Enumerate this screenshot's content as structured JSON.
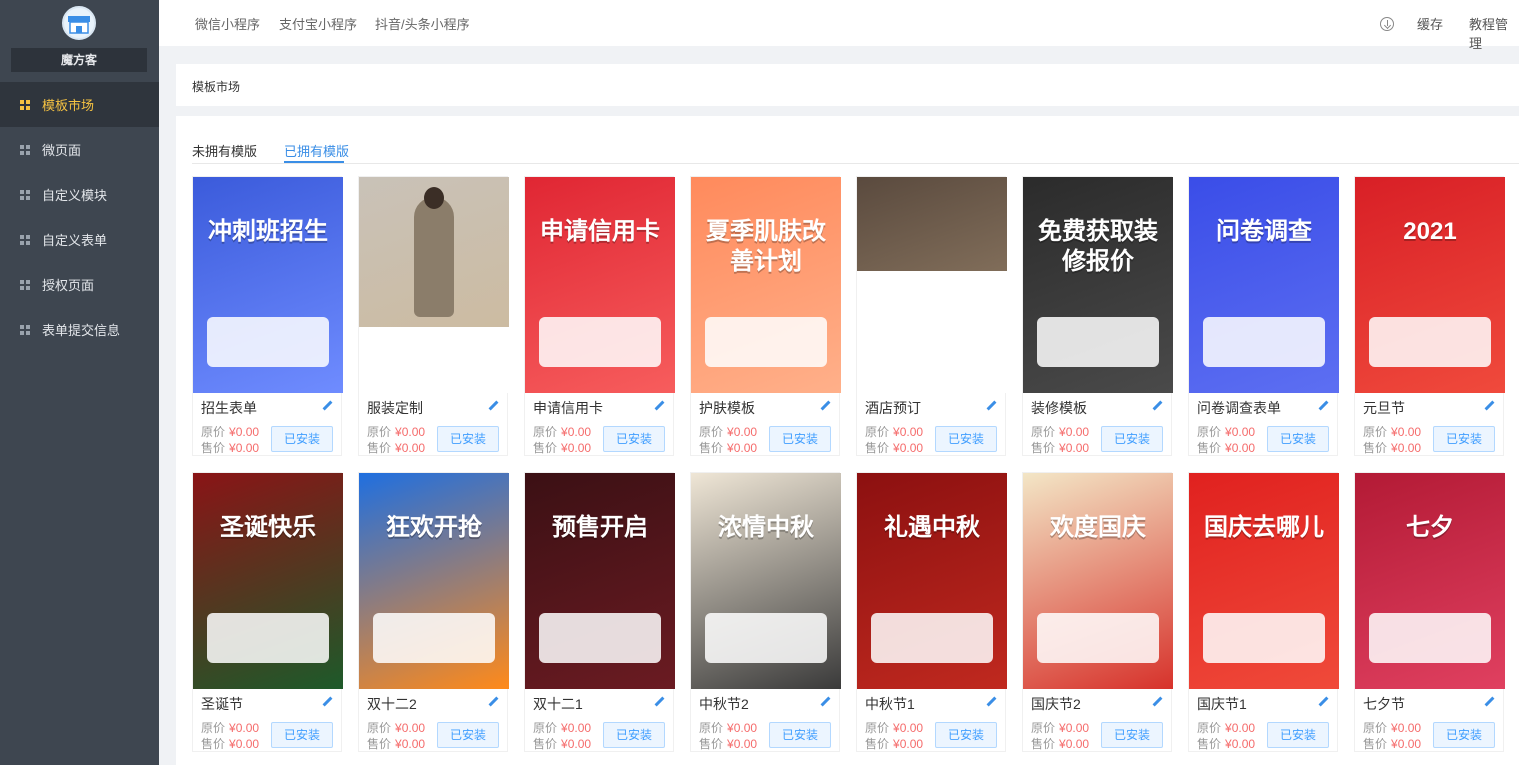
{
  "sidebar": {
    "shop_name": "魔方客",
    "items": [
      {
        "label": "模板市场",
        "active": true
      },
      {
        "label": "微页面",
        "active": false
      },
      {
        "label": "自定义模块",
        "active": false
      },
      {
        "label": "自定义表单",
        "active": false
      },
      {
        "label": "授权页面",
        "active": false
      },
      {
        "label": "表单提交信息",
        "active": false
      }
    ]
  },
  "topbar": {
    "tabs": [
      "微信小程序",
      "支付宝小程序",
      "抖音/头条小程序"
    ],
    "cache_label": "缓存",
    "tutorial_label": "教程管理"
  },
  "page": {
    "title": "模板市场",
    "tabs": [
      "未拥有模版",
      "已拥有模版"
    ],
    "active_tab": "已拥有模版"
  },
  "labels": {
    "original_price": "原价",
    "sale_price": "售价",
    "install_button": "已安装"
  },
  "templates": [
    {
      "name": "招生表单",
      "original_price": "¥0.00",
      "sale_price": "¥0.00",
      "cover_text": "冲刺班招生",
      "colors": [
        "#3b5bdb",
        "#6f8cff"
      ]
    },
    {
      "name": "服装定制",
      "original_price": "¥0.00",
      "sale_price": "¥0.00",
      "cover_text": "",
      "colors": [
        "#c9c2b8",
        "#cdb99a"
      ]
    },
    {
      "name": "申请信用卡",
      "original_price": "¥0.00",
      "sale_price": "¥0.00",
      "cover_text": "申请信用卡",
      "colors": [
        "#e02633",
        "#f75d5d"
      ]
    },
    {
      "name": "护肤模板",
      "original_price": "¥0.00",
      "sale_price": "¥0.00",
      "cover_text": "夏季肌肤改善计划",
      "colors": [
        "#ff8a5c",
        "#ffb08a"
      ]
    },
    {
      "name": "酒店预订",
      "original_price": "¥0.00",
      "sale_price": "¥0.00",
      "cover_text": "",
      "colors": [
        "#5a4a3e",
        "#a08a70"
      ]
    },
    {
      "name": "装修模板",
      "original_price": "¥0.00",
      "sale_price": "¥0.00",
      "cover_text": "免费获取装修报价",
      "colors": [
        "#2b2b2b",
        "#4a4a4a"
      ]
    },
    {
      "name": "问卷调查表单",
      "original_price": "¥0.00",
      "sale_price": "¥0.00",
      "cover_text": "问卷调查",
      "colors": [
        "#3a4de8",
        "#5d6ff2"
      ]
    },
    {
      "name": "元旦节",
      "original_price": "¥0.00",
      "sale_price": "¥0.00",
      "cover_text": "2021",
      "colors": [
        "#d81f26",
        "#f04a3c"
      ]
    },
    {
      "name": "圣诞节",
      "original_price": "¥0.00",
      "sale_price": "¥0.00",
      "cover_text": "圣诞快乐",
      "colors": [
        "#8a1416",
        "#1d5a2a"
      ]
    },
    {
      "name": "双十二2",
      "original_price": "¥0.00",
      "sale_price": "¥0.00",
      "cover_text": "狂欢开抢",
      "colors": [
        "#1f6fe0",
        "#ff8a1a"
      ]
    },
    {
      "name": "双十二1",
      "original_price": "¥0.00",
      "sale_price": "¥0.00",
      "cover_text": "预售开启",
      "colors": [
        "#3b1014",
        "#6b1b22"
      ]
    },
    {
      "name": "中秋节2",
      "original_price": "¥0.00",
      "sale_price": "¥0.00",
      "cover_text": "浓情中秋",
      "colors": [
        "#efe6d6",
        "#3a3a3a"
      ]
    },
    {
      "name": "中秋节1",
      "original_price": "¥0.00",
      "sale_price": "¥0.00",
      "cover_text": "礼遇中秋",
      "colors": [
        "#8c1010",
        "#c0291f"
      ]
    },
    {
      "name": "国庆节2",
      "original_price": "¥0.00",
      "sale_price": "¥0.00",
      "cover_text": "欢度国庆",
      "colors": [
        "#f3e6c6",
        "#d7322b"
      ]
    },
    {
      "name": "国庆节1",
      "original_price": "¥0.00",
      "sale_price": "¥0.00",
      "cover_text": "国庆去哪儿",
      "colors": [
        "#e0211f",
        "#f04a3a"
      ]
    },
    {
      "name": "七夕节",
      "original_price": "¥0.00",
      "sale_price": "¥0.00",
      "cover_text": "七夕",
      "colors": [
        "#b31a35",
        "#e04060"
      ]
    }
  ]
}
